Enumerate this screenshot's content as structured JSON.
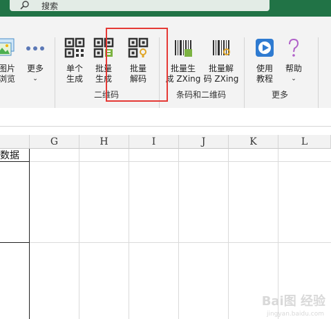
{
  "search": {
    "text": "搜索"
  },
  "ribbon": {
    "buttons": {
      "image_browse": "图片\n浏览",
      "more": "更多",
      "single_generate": "单个\n生成",
      "batch_generate": "批量\n生成",
      "batch_decode": "批量\n解码",
      "batch_generate_zxing": "批量生\n成 ZXing",
      "batch_decode_zxing": "批量解\n码 ZXing",
      "tutorial": "使用\n教程",
      "help": "帮助"
    },
    "groups": {
      "qrcode": "二维码",
      "barcode_qrcode": "条码和二维码",
      "more": "更多"
    }
  },
  "sheet": {
    "columns": [
      "G",
      "H",
      "I",
      "J",
      "K",
      "L"
    ],
    "cell_text": "数据"
  },
  "watermark": {
    "main": "Bai图 经验",
    "sub": "jingyan.baidu.com"
  },
  "colors": {
    "title_bar": "#217346",
    "highlight": "#e53935",
    "accent_blue": "#2f7bd1",
    "help_purple": "#b061c9"
  }
}
